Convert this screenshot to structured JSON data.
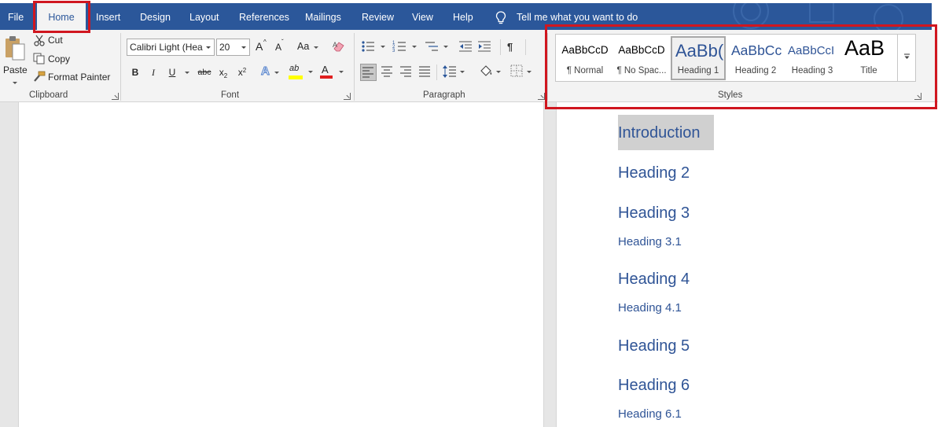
{
  "menu": {
    "tabs": [
      {
        "label": "File"
      },
      {
        "label": "Home"
      },
      {
        "label": "Insert"
      },
      {
        "label": "Design"
      },
      {
        "label": "Layout"
      },
      {
        "label": "References"
      },
      {
        "label": "Mailings"
      },
      {
        "label": "Review"
      },
      {
        "label": "View"
      },
      {
        "label": "Help"
      }
    ],
    "tell_me": "Tell me what you want to do"
  },
  "clipboard": {
    "paste_label": "Paste",
    "cut_label": "Cut",
    "copy_label": "Copy",
    "format_painter_label": "Format Painter",
    "group_label": "Clipboard"
  },
  "font": {
    "font_name": "Calibri Light (Hea",
    "font_size": "20",
    "group_label": "Font",
    "bold": "B",
    "italic": "I",
    "underline": "U",
    "strike": "abc",
    "subscript": "x",
    "superscript": "x",
    "grow": "A",
    "shrink": "A",
    "change_case": "Aa",
    "text_effects": "A",
    "font_color": "A",
    "highlight": "ab",
    "font_color_value": "#e02020",
    "highlight_color_value": "#ffff00"
  },
  "paragraph": {
    "group_label": "Paragraph",
    "pilcrow": "¶"
  },
  "styles": {
    "group_label": "Styles",
    "items": [
      {
        "sample": "AaBbCcD",
        "name": "¶ Normal"
      },
      {
        "sample": "AaBbCcD",
        "name": "¶ No Spac..."
      },
      {
        "sample": "AaBb(",
        "name": "Heading 1"
      },
      {
        "sample": "AaBbCc",
        "name": "Heading 2"
      },
      {
        "sample": "AaBbCcI",
        "name": "Heading 3"
      },
      {
        "sample": "AaB",
        "name": "Title"
      }
    ]
  },
  "document": {
    "headings": [
      {
        "text": "Introduction"
      },
      {
        "text": "Heading 2"
      },
      {
        "text": "Heading 3"
      },
      {
        "text": "Heading 3.1"
      },
      {
        "text": "Heading 4"
      },
      {
        "text": "Heading 4.1"
      },
      {
        "text": "Heading 5"
      },
      {
        "text": "Heading 6"
      },
      {
        "text": "Heading 6.1"
      }
    ],
    "heading_color": "#2f5496"
  },
  "colors": {
    "brand_blue": "#2b579a",
    "annotation_red": "#d0161f"
  }
}
